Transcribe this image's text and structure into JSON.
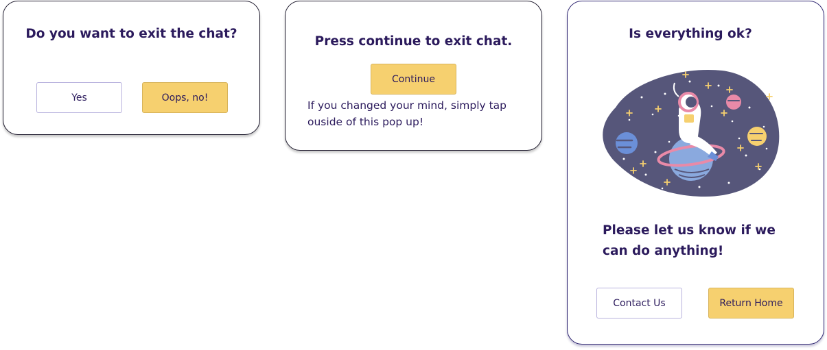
{
  "dialog_exit": {
    "title": "Do you want to exit the chat?",
    "yes_label": "Yes",
    "no_label": "Oops, no!"
  },
  "dialog_continue": {
    "title": "Press continue to exit chat.",
    "continue_label": "Continue",
    "hint": "If you changed your mind, simply tap ouside of this pop up!"
  },
  "dialog_feedback": {
    "title": "Is everything ok?",
    "illustration": "astronaut-in-space-illustration",
    "message": "Please let us know if we can do anything!",
    "contact_label": "Contact Us",
    "home_label": "Return Home"
  },
  "colors": {
    "text": "#2b1a5c",
    "primary_button": "#f6d06f",
    "outline_border": "#b7b1dd",
    "illustration_bg": "#56567a"
  }
}
